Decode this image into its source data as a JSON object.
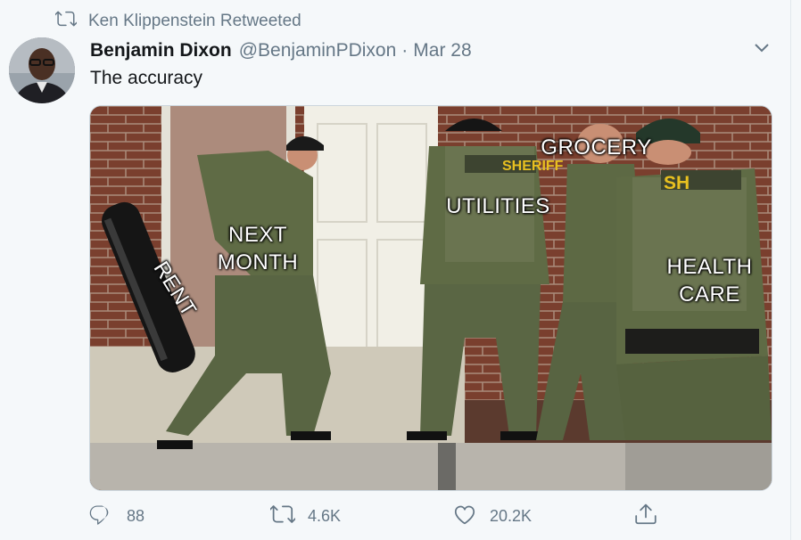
{
  "retweet": {
    "text": "Ken Klippenstein Retweeted",
    "icon": "retweet-icon"
  },
  "author": {
    "name": "Benjamin Dixon",
    "handle": "@BenjaminPDixon",
    "separator": "·",
    "date": "Mar 28"
  },
  "tweet_text": "The accuracy",
  "meme_labels": {
    "ram": "RENT",
    "officer1": "NEXT\nMONTH",
    "officer2": "UTILITIES",
    "officer3": "GROCERY",
    "officer4": "HEALTH\nCARE"
  },
  "vest_text": {
    "sheriff": "SHERIFF",
    "sheriff_partial": "SH"
  },
  "actions": {
    "reply_count": "88",
    "retweet_count": "4.6K",
    "like_count": "20.2K"
  },
  "colors": {
    "background": "#f5f8fa",
    "muted": "#657786",
    "text": "#14171a",
    "uniform": "#5f6b45",
    "brick": "#7a3f2e"
  }
}
